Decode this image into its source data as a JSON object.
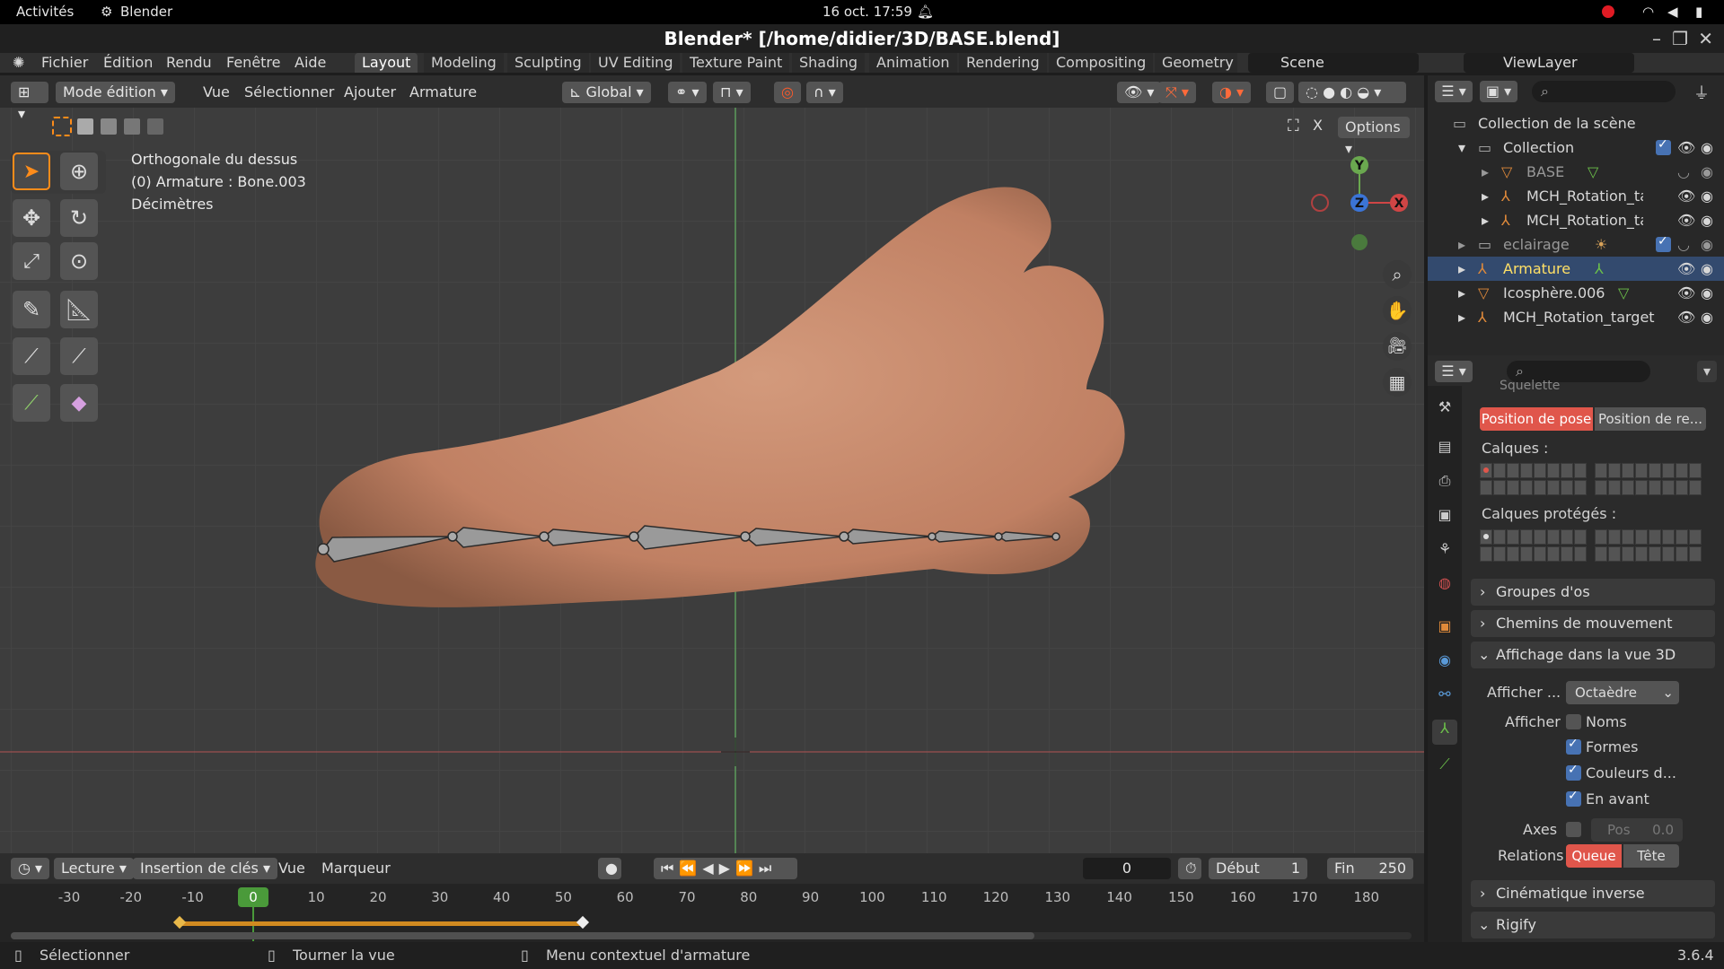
{
  "gnome": {
    "activities": "Activités",
    "app": "Blender",
    "datetime": "16 oct.  17:59"
  },
  "title": "Blender* [/home/didier/3D/BASE.blend]",
  "menu": [
    "Fichier",
    "Édition",
    "Rendu",
    "Fenêtre",
    "Aide"
  ],
  "workspaces": [
    "Layout",
    "Modeling",
    "Sculpting",
    "UV Editing",
    "Texture Paint",
    "Shading",
    "Animation",
    "Rendering",
    "Compositing",
    "Geometry N"
  ],
  "scene": "Scene",
  "viewlayer": "ViewLayer",
  "viewport_header": {
    "mode": "Mode édition",
    "menus": [
      "Vue",
      "Sélectionner",
      "Ajouter",
      "Armature"
    ],
    "orientation": "Global",
    "options": "Options"
  },
  "overlay": {
    "view": "Orthogonale du dessus",
    "object": "(0) Armature : Bone.003",
    "units": "Décimètres"
  },
  "gizmo": {
    "y": "Y",
    "z": "Z",
    "x": "X"
  },
  "outliner": {
    "rows": [
      {
        "label": "Collection de la scène"
      },
      {
        "label": "Collection"
      },
      {
        "label": "BASE"
      },
      {
        "label": "MCH_Rotation_ta"
      },
      {
        "label": "MCH_Rotation_ta"
      },
      {
        "label": "eclairage"
      },
      {
        "label": "Armature"
      },
      {
        "label": "Icosphère.006"
      },
      {
        "label": "MCH_Rotation_target"
      }
    ]
  },
  "properties": {
    "section_partial": "Squelette",
    "pose_position": "Position de pose",
    "rest_position": "Position de re...",
    "layers": "Calques :",
    "protected_layers": "Calques protégés :",
    "panels": [
      "Groupes d'os",
      "Chemins de mouvement",
      "Affichage dans la vue 3D",
      "Cinématique inverse",
      "Rigify"
    ],
    "display_as_label": "Afficher ...",
    "display_as_value": "Octaèdre",
    "show_label": "Afficher",
    "checks": [
      {
        "label": "Noms",
        "on": false
      },
      {
        "label": "Formes",
        "on": true
      },
      {
        "label": "Couleurs d...",
        "on": true
      },
      {
        "label": "En avant",
        "on": true
      }
    ],
    "axes_label": "Axes",
    "pos_label": "Pos",
    "pos_value": "0.0",
    "relations_label": "Relations",
    "relations_tail": "Queue",
    "relations_head": "Tête"
  },
  "timeline": {
    "menus": [
      "Lecture",
      "Insertion de clés",
      "Vue",
      "Marqueur"
    ],
    "current": "0",
    "start_label": "Début",
    "start": "1",
    "end_label": "Fin",
    "end": "250",
    "ticks": [
      "-30",
      "-20",
      "-10",
      "0",
      "10",
      "20",
      "30",
      "40",
      "50",
      "60",
      "70",
      "80",
      "90",
      "100",
      "110",
      "120",
      "130",
      "140",
      "150",
      "160",
      "170",
      "180"
    ],
    "frame_marker": "0"
  },
  "status": {
    "select": "Sélectionner",
    "rotate": "Tourner la vue",
    "context": "Menu contextuel d'armature",
    "version": "3.6.4"
  },
  "colors": {
    "accent": "#ff8c1a",
    "select_blue": "#4772b3",
    "active_red": "#e0564b",
    "skin": "#c8876a"
  }
}
